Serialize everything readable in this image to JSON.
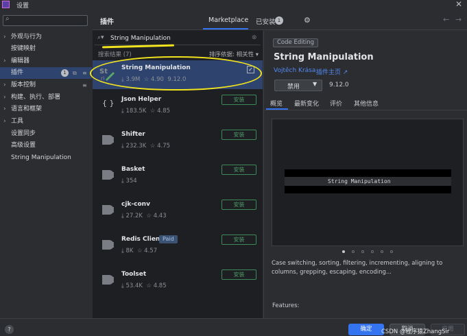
{
  "window": {
    "title": "设置",
    "close_label": "✕"
  },
  "sidebar": {
    "search_placeholder": "",
    "items": [
      {
        "label": "外观与行为",
        "expandable": true
      },
      {
        "label": "按键映射",
        "expandable": false
      },
      {
        "label": "编辑器",
        "expandable": true
      },
      {
        "label": "插件",
        "expandable": false,
        "badge": "1",
        "selected": true
      },
      {
        "label": "版本控制",
        "expandable": true
      },
      {
        "label": "构建、执行、部署",
        "expandable": true
      },
      {
        "label": "语言和框架",
        "expandable": true
      },
      {
        "label": "工具",
        "expandable": true
      },
      {
        "label": "设置同步",
        "expandable": false
      },
      {
        "label": "高级设置",
        "expandable": false
      },
      {
        "label": "String Manipulation",
        "expandable": false
      }
    ]
  },
  "header": {
    "title": "插件",
    "tab_marketplace": "Marketplace",
    "tab_installed": "已安装",
    "installed_count": "1"
  },
  "search": {
    "value": "String Manipulation",
    "results_label": "搜索结果 (7)",
    "sort_label": "排序依据: 相关性 ▾"
  },
  "plugins": [
    {
      "name": "String Manipulation",
      "downloads": "⤓ 3.9M",
      "rating": "☆ 4.90",
      "version": "9.12.0",
      "installed": true
    },
    {
      "name": "Json Helper",
      "downloads": "⤓ 183.5K",
      "rating": "☆ 4.85",
      "action": "安装"
    },
    {
      "name": "Shifter",
      "downloads": "⤓ 232.3K",
      "rating": "☆ 4.75",
      "action": "安装"
    },
    {
      "name": "Basket",
      "downloads": "⤓ 354",
      "rating": "",
      "action": "安装"
    },
    {
      "name": "cjk-conv",
      "downloads": "⤓ 27.2K",
      "rating": "☆ 4.43",
      "action": "安装"
    },
    {
      "name": "Redis Client",
      "badge": "Paid",
      "downloads": "⤓ 8K",
      "rating": "☆ 4.57",
      "action": "安装"
    },
    {
      "name": "Toolset",
      "downloads": "⤓ 53.4K",
      "rating": "☆ 4.85",
      "action": "安装"
    }
  ],
  "detail": {
    "tag": "Code Editing",
    "title": "String Manipulation",
    "vendor": "Vojtěch Krása",
    "homepage": "插件主页 ↗",
    "disable_label": "禁用",
    "version": "9.12.0",
    "tabs": [
      "概览",
      "最新变化",
      "评价",
      "其他信息"
    ],
    "preview_text": "String Manipulation",
    "description": "Case switching, sorting, filtering, incrementing, aligning to columns, grepping, escaping, encoding...",
    "features_label": "Features:"
  },
  "footer": {
    "help": "?",
    "ok": "确定",
    "cancel": "取消",
    "apply": "应用",
    "watermark": "CSDN @程序猿ZhangSir"
  },
  "colors": {
    "accent": "#3574f0",
    "annotation": "#f1e31e",
    "install_green": "#4e9e6a"
  }
}
